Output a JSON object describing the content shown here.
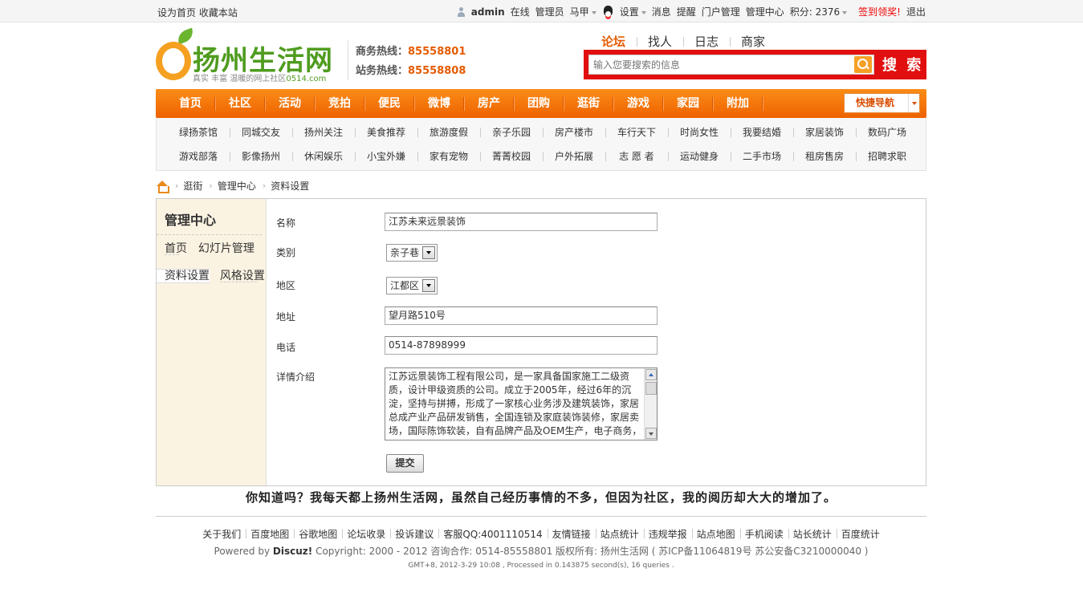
{
  "topbar": {
    "set_home": "设为首页",
    "bookmark": "收藏本站",
    "username": "admin",
    "online": "在线",
    "group": "管理员",
    "horse": "马甲",
    "settings": "设置",
    "messages": "消息",
    "reminders": "提醒",
    "portal_admin": "门户管理",
    "admin_center": "管理中心",
    "points": "积分: 2376",
    "sign_in": "签到领奖!",
    "logout": "退出"
  },
  "header": {
    "site_name": "扬州生活网",
    "slogan_prefix": "真实  丰富  温暖的网上社区",
    "slogan_domain": "0514.com",
    "hotline1_label": "商务热线：",
    "hotline1_number": "85558801",
    "hotline2_label": "站务热线：",
    "hotline2_number": "85558808"
  },
  "search": {
    "tabs": [
      "论坛",
      "找人",
      "日志",
      "商家"
    ],
    "active_tab": "论坛",
    "placeholder": "输入您要搜索的信息",
    "button": "搜 索"
  },
  "nav": {
    "items": [
      "首页",
      "社区",
      "活动",
      "竞拍",
      "便民",
      "微博",
      "房产",
      "团购",
      "逛街",
      "游戏",
      "家园",
      "附加"
    ],
    "quick_nav": "快捷导航"
  },
  "subnav": {
    "row1": [
      "绿扬茶馆",
      "同城交友",
      "扬州关注",
      "美食推荐",
      "旅游度假",
      "亲子乐园",
      "房产楼市",
      "车行天下",
      "时尚女性",
      "我要结婚",
      "家居装饰",
      "数码广场"
    ],
    "row2": [
      "游戏部落",
      "影像扬州",
      "休闲娱乐",
      "小宝外嫌",
      "家有宠物",
      "菁菁校园",
      "户外拓展",
      "志 愿 者",
      "运动健身",
      "二手市场",
      "租房售房",
      "招聘求职"
    ]
  },
  "breadcrumb": {
    "items": [
      "逛街",
      "管理中心",
      "资料设置"
    ],
    "separator": "›"
  },
  "sidebar": {
    "title": "管理中心",
    "items": [
      "首页",
      "幻灯片管理",
      "资料设置",
      "风格设置"
    ],
    "active": "资料设置"
  },
  "form": {
    "name_label": "名称",
    "name_value": "江苏未来远景装饰",
    "category_label": "类别",
    "category_value": "亲子巷",
    "district_label": "地区",
    "district_value": "江都区",
    "address_label": "地址",
    "address_value": "望月路510号",
    "phone_label": "电话",
    "phone_value": "0514-87898999",
    "detail_label": "详情介绍",
    "detail_value": "江苏远景装饰工程有限公司，是一家具备国家施工二级资质，设计甲级资质的公司。成立于2005年，经过6年的沉淀，坚持与拼搏，形成了一家核心业务涉及建筑装饰，家居总成产业产品研发销售，全国连锁及家庭装饰装修，家居卖场，国际陈饰软装，自有品牌产品及OEM生产，电子商务，",
    "submit": "提交"
  },
  "tip": "你知道吗？我每天都上扬州生活网，虽然自己经历事情的不多，但因为社区，我的阅历却大大的增加了。",
  "footer": {
    "links": [
      "关于我们",
      "百度地图",
      "谷歌地图",
      "论坛收录",
      "投诉建议",
      "客服QQ:4001110514",
      "友情链接",
      "站点统计",
      "违规举报",
      "站点地图",
      "手机阅读",
      "站长统计",
      "百度统计"
    ],
    "powered_prefix": "Powered by",
    "powered_brand": "Discuz!",
    "copyright_rest": "Copyright: 2000 - 2012    咨询合作: 0514-85558801 版权所有: 扬州生活网 ( 苏ICP备11064819号 苏公安备C3210000040 )",
    "debug": "GMT+8, 2012-3-29 10:08 , Processed in 0.143875 second(s), 16 queries ."
  }
}
